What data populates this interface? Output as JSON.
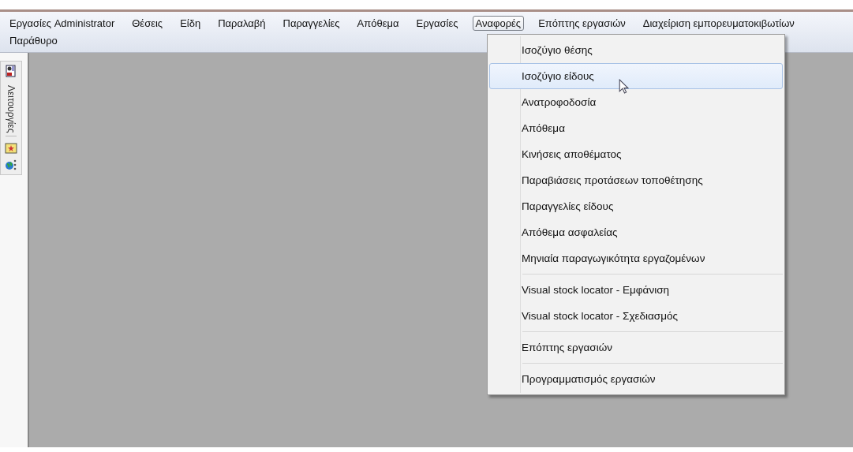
{
  "menu_bar": {
    "rows": [
      [
        {
          "label": "Εργασίες Administrator",
          "selected": false
        },
        {
          "label": "Θέσεις",
          "selected": false
        },
        {
          "label": "Είδη",
          "selected": false
        },
        {
          "label": "Παραλαβή",
          "selected": false
        },
        {
          "label": "Παραγγελίες",
          "selected": false
        },
        {
          "label": "Απόθεμα",
          "selected": false
        },
        {
          "label": "Εργασίες",
          "selected": false
        },
        {
          "label": "Αναφορές",
          "selected": true
        },
        {
          "label": "Επόπτης εργασιών",
          "selected": false
        },
        {
          "label": "Διαχείριση εμπορευματοκιβωτίων",
          "selected": false
        }
      ],
      [
        {
          "label": "Παράθυρο",
          "selected": false
        }
      ]
    ]
  },
  "side_toolbar": {
    "label": "Λειτουργίες"
  },
  "dropdown_menu": {
    "groups": [
      [
        {
          "label": "Ισοζύγιο θέσης",
          "selected": false
        },
        {
          "label": "Ισοζύγιο είδους",
          "selected": true
        },
        {
          "label": "Ανατροφοδοσία",
          "selected": false
        },
        {
          "label": "Απόθεμα",
          "selected": false
        },
        {
          "label": "Κινήσεις αποθέματος",
          "selected": false
        },
        {
          "label": "Παραβιάσεις προτάσεων τοποθέτησης",
          "selected": false
        },
        {
          "label": "Παραγγελίες είδους",
          "selected": false
        },
        {
          "label": "Απόθεμα ασφαλείας",
          "selected": false
        },
        {
          "label": "Μηνιαία παραγωγικότητα εργαζομένων",
          "selected": false
        }
      ],
      [
        {
          "label": "Visual stock locator - Εμφάνιση",
          "selected": false
        },
        {
          "label": "Visual stock locator - Σχεδιασμός",
          "selected": false
        }
      ],
      [
        {
          "label": "Επόπτης εργασιών",
          "selected": false
        }
      ],
      [
        {
          "label": "Προγραμματισμός εργασιών",
          "selected": false
        }
      ]
    ]
  }
}
